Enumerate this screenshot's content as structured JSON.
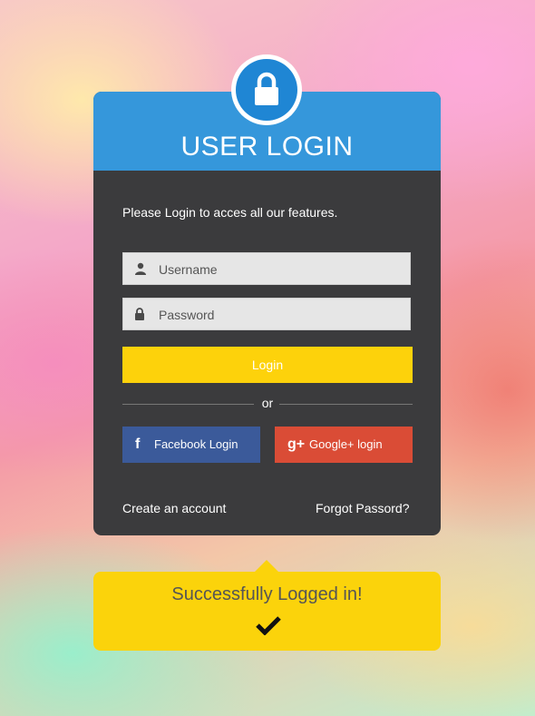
{
  "header": {
    "title": "USER LOGIN",
    "lock_icon": "lock-icon"
  },
  "form": {
    "intro": "Please Login to acces all our features.",
    "username": {
      "placeholder": "Username",
      "value": ""
    },
    "password": {
      "placeholder": "Password",
      "value": ""
    },
    "login_label": "Login",
    "or_label": "or"
  },
  "social": {
    "facebook_label": "Facebook Login",
    "facebook_icon": "f",
    "google_label": "Google+ login",
    "google_icon": "g+"
  },
  "links": {
    "create_account": "Create an account",
    "forgot_password": "Forgot Passord?"
  },
  "notice": {
    "text": "Successfully Logged in!"
  },
  "colors": {
    "header_blue": "#3597db",
    "card_dark": "#3b3b3d",
    "accent_yellow": "#fdd20b",
    "facebook_blue": "#3b5a9a",
    "google_red": "#da4c36"
  }
}
